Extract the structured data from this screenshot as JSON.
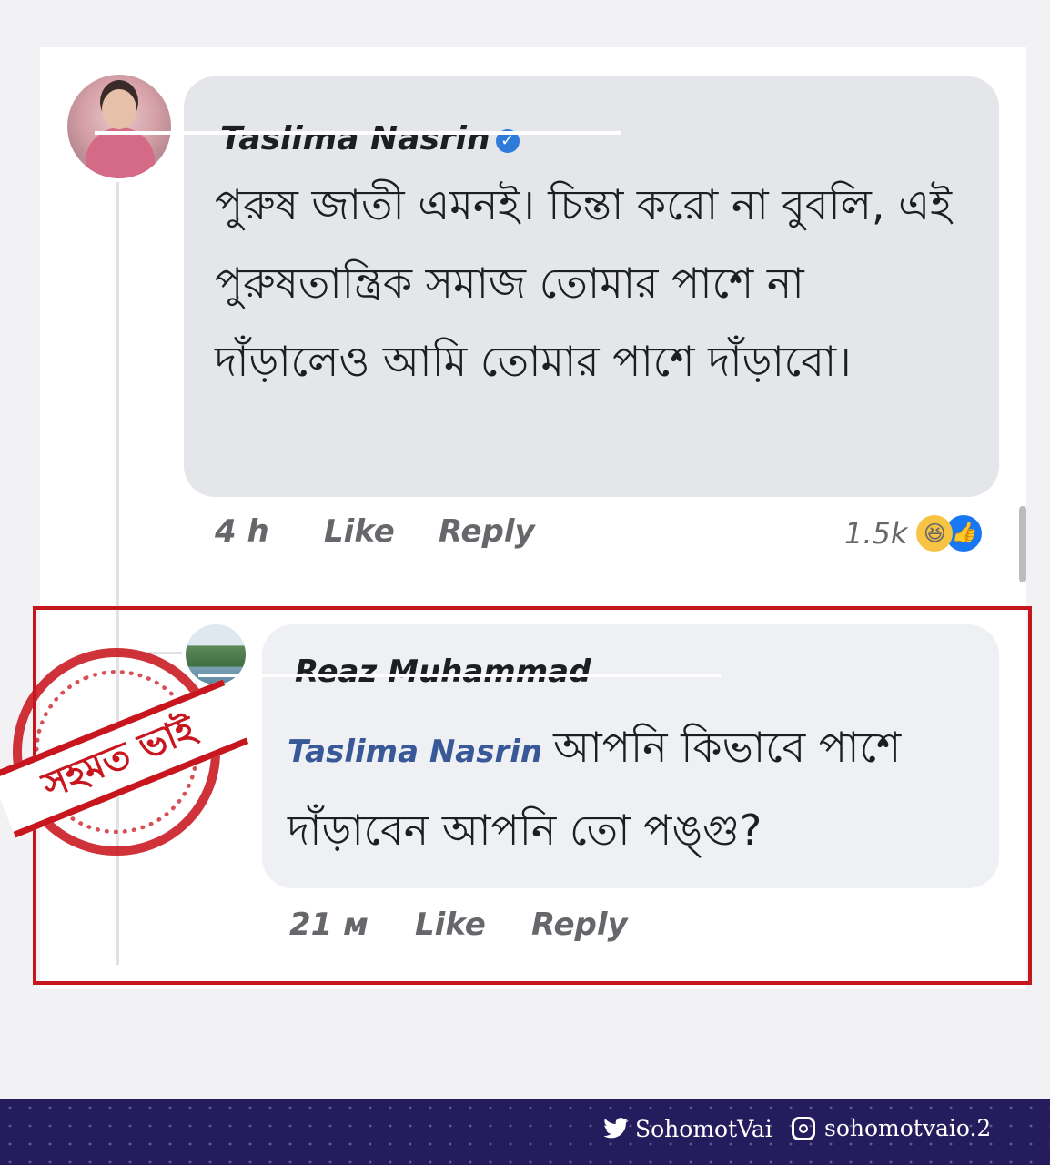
{
  "comment": {
    "author": "Taslima Nasrin",
    "text": "পুরুষ জাতী এমনই। চিন্তা করো না বুবলি, এই পুরুষতান্ত্রিক সমাজ তোমার পাশে না দাঁড়ালেও আমি তোমার পাশে দাঁড়াবো।",
    "time": "4 h",
    "like_label": "Like",
    "reply_label": "Reply",
    "reaction_count": "1.5k",
    "reactions": [
      "haha",
      "like"
    ]
  },
  "reply": {
    "author": "Reaz Muhammad",
    "mention": "Taslima Nasrin",
    "text": "আপনি কিভাবে পাশে দাঁড়াবেন আপনি তো পঙ্গু?",
    "time": "21 м",
    "like_label": "Like",
    "reply_label": "Reply"
  },
  "stamp": {
    "text": "সহমত ভাই"
  },
  "footer": {
    "twitter_handle": "SohomotVai",
    "instagram_handle": "sohomotvaio.2"
  },
  "colors": {
    "highlight": "#c4161c",
    "footer_bg": "#241c5c",
    "bubble": "#e5e6ea"
  }
}
